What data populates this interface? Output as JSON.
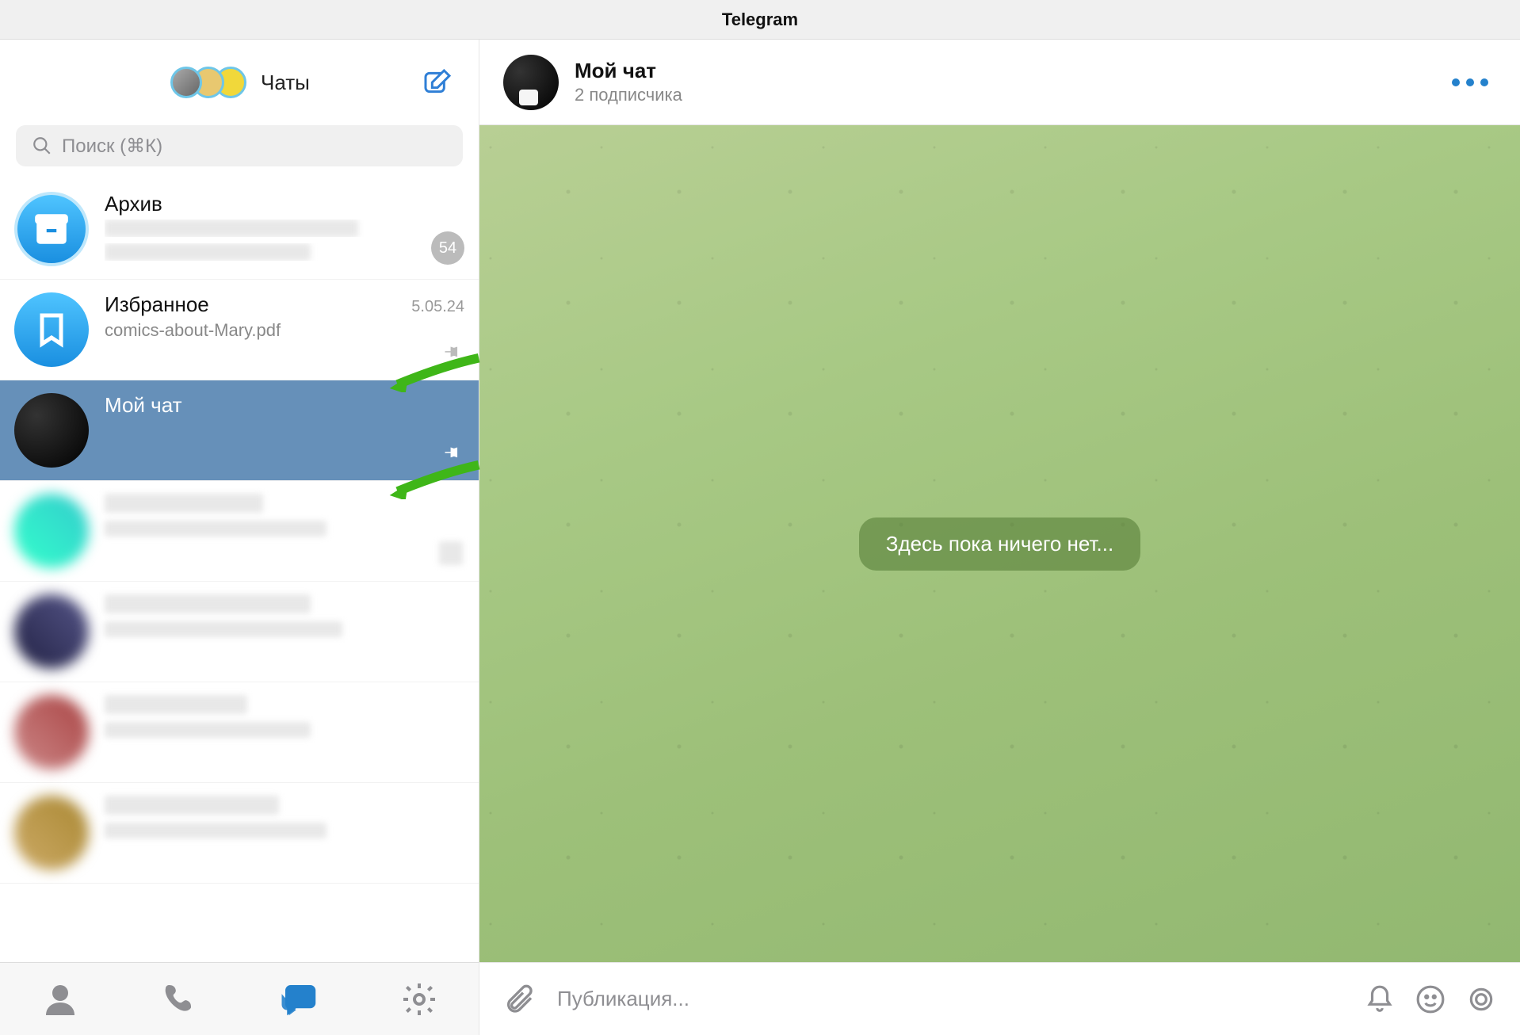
{
  "app_title": "Telegram",
  "sidebar": {
    "title": "Чаты",
    "search_placeholder": "Поиск (⌘К)",
    "archive": {
      "title": "Архив",
      "badge": "54"
    },
    "saved": {
      "title": "Избранное",
      "time": "5.05.24",
      "preview": "comics-about-Mary.pdf"
    },
    "mychat": {
      "title": "Мой чат"
    }
  },
  "chat_header": {
    "title": "Мой чат",
    "subtitle": "2 подписчика"
  },
  "empty_label": "Здесь пока ничего нет...",
  "input_placeholder": "Публикация..."
}
